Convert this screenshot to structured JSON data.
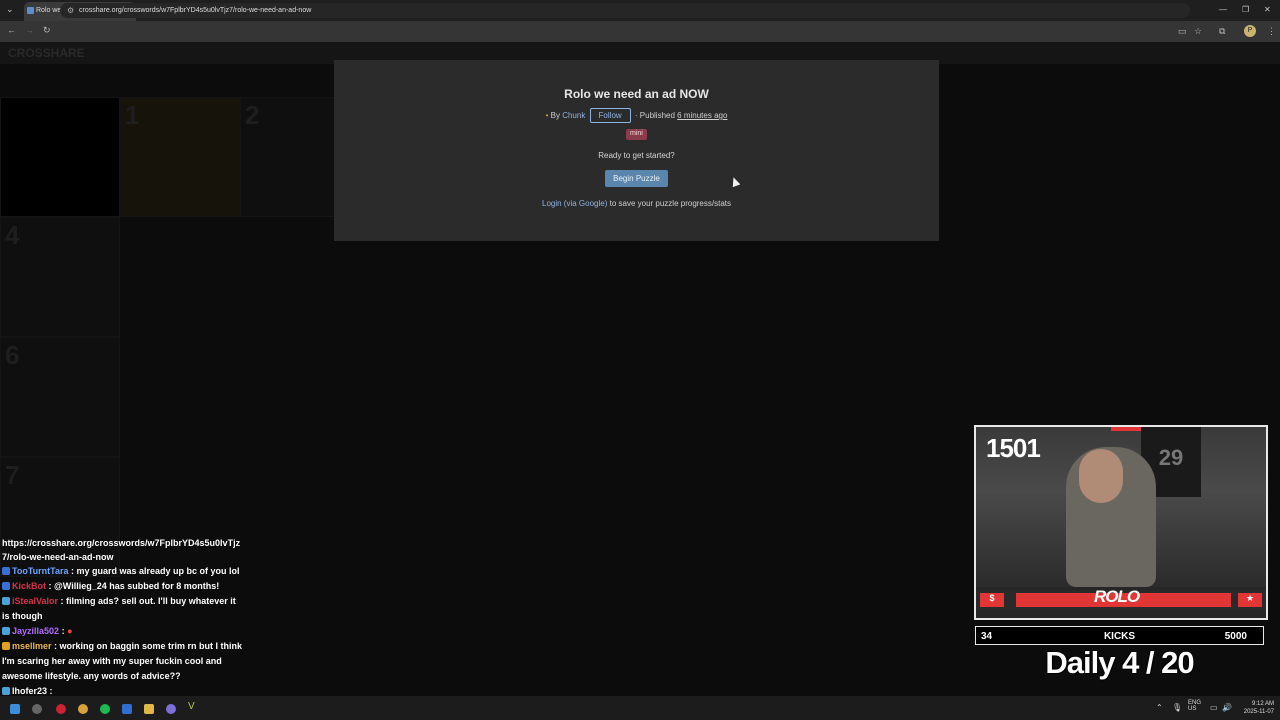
{
  "browser": {
    "tab_title": "Rolo we need an ad NOW | Cr...",
    "url": "crosshare.org/crosswords/w7FplbrYD4s5u0lvTjz7/rolo-we-need-an-ad-now"
  },
  "site": {
    "logo": "CROSSHARE",
    "grid_numbers": [
      "1",
      "2",
      "4",
      "6",
      "7"
    ]
  },
  "modal": {
    "title": "Rolo we need an ad NOW",
    "by_prefix": "By",
    "author": "Chunk",
    "follow_label": "Follow",
    "published_prefix": "· Published",
    "published_ago": "6 minutes ago",
    "tag": "mini",
    "ready_text": "Ready to get started?",
    "begin_label": "Begin Puzzle",
    "login_link": "Login (via Google)",
    "login_suffix": "to save your puzzle progress/stats"
  },
  "chat": {
    "url_line": "https://crosshare.org/crosswords/w7FplbrYD4s5u0lvTjz7/rolo-we-need-an-ad-now",
    "messages": [
      {
        "user": "TooTurntTara",
        "text": ": my guard was already up bc of you lol",
        "color": "#6aa5ff"
      },
      {
        "user": "KickBot",
        "text": ": @Willieg_24 has subbed for 8 months!",
        "color": "#d8324b"
      },
      {
        "user": "iStealValor",
        "text": ": filming ads? sell out. I'll buy whatever it is though",
        "color": "#d8324b"
      },
      {
        "user": "Jayzilla502",
        "text": ":",
        "color": "#b36bff"
      },
      {
        "user": "msellmer",
        "text": ": working on baggin some trim rn but I think I'm scaring her away with my super fuckin cool and awesome lifestyle. any words of advice??",
        "color": "#e9b44c"
      },
      {
        "user": "lhofer23",
        "text": ":",
        "color": "#ffffff"
      }
    ]
  },
  "stream": {
    "count": "1501",
    "jersey": "29",
    "logo": "ROLO",
    "money_icon": "$",
    "star_icon": "★",
    "kicks_left": "34",
    "kicks_label": "KICKS",
    "kicks_right": "5000",
    "daily": "Daily  4 / 20"
  },
  "taskbar": {
    "lang": "ENG",
    "region": "US",
    "time": "9:12 AM",
    "date": "2025-11-07"
  }
}
